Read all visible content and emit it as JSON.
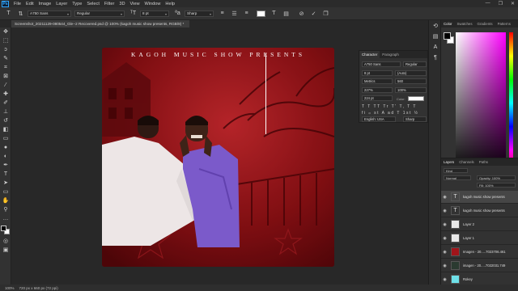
{
  "menubar": {
    "logo": "Ps",
    "items": [
      "File",
      "Edit",
      "Image",
      "Layer",
      "Type",
      "Select",
      "Filter",
      "3D",
      "View",
      "Window",
      "Help"
    ]
  },
  "options": {
    "font_family": "A750 Sans",
    "font_style": "Regular",
    "font_size": "8 pt",
    "antialias": "Sharp"
  },
  "document": {
    "tab_title": "Screenshot_20211129-080544_Gle--2 Recovered.psd @ 100% (kagoh music show presents, RGB/8) *",
    "poster_title": "KAGOH MUSIC SHOW PRESENTS"
  },
  "status": {
    "zoom": "100%",
    "doc_info": "720 px x 660 px (72 ppi)"
  },
  "character_panel": {
    "tabs": [
      "Character",
      "Paragraph"
    ],
    "font_family": "A750 Sans",
    "font_style": "Regular",
    "size": "8 pt",
    "leading": "(Auto)",
    "kerning": "Metrics",
    "tracking": "560",
    "vscale": "227%",
    "hscale": "100%",
    "baseline": "224 pt",
    "color_label": "Color:",
    "language": "English: USA",
    "aa": "Sharp"
  },
  "right_panel": {
    "color_tabs": [
      "Color",
      "Swatches",
      "Gradients",
      "Patterns"
    ],
    "layers_tabs": [
      "Layers",
      "Channels",
      "Paths"
    ],
    "kind_label": "Kind",
    "blend_mode": "Normal",
    "opacity_label": "Opacity: 100%",
    "fill_label": "Fill: 100%"
  },
  "layers": [
    {
      "name": "kagoh music show presents",
      "thumb": "T",
      "selected": true
    },
    {
      "name": "kagoh music show presents",
      "thumb": "T",
      "selected": false
    },
    {
      "name": "Layer 2",
      "thumb": "",
      "selected": false
    },
    {
      "name": "Layer 1",
      "thumb": "",
      "selected": false
    },
    {
      "name": "Imagen - 20.....7023706.461",
      "thumb": "",
      "selected": false
    },
    {
      "name": "imagen - 20.....7022031.749",
      "thumb": "",
      "selected": false
    },
    {
      "name": "Rokey",
      "thumb": "",
      "selected": false
    }
  ],
  "colors": {
    "background_red": "#8a1217",
    "purple_shirt": "#7b5fd6",
    "accent_blue": "#31a8ff"
  }
}
